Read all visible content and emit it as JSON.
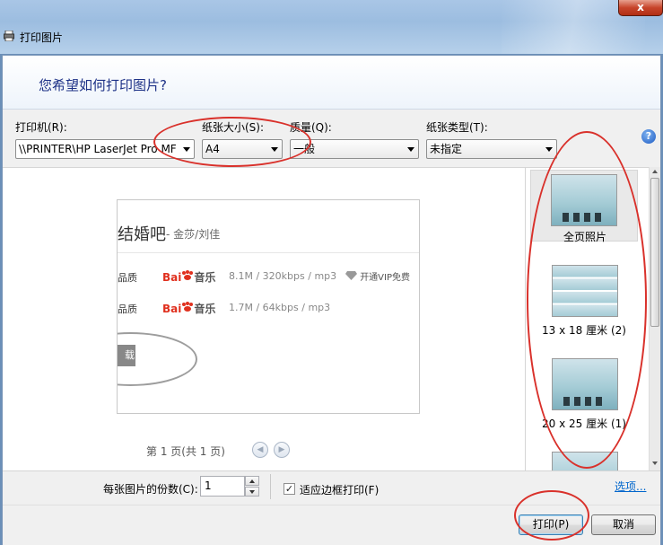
{
  "window": {
    "title": "打印图片",
    "close_label": "x"
  },
  "header": {
    "title": "您希望如何打印图片?"
  },
  "fields": {
    "printer": {
      "label": "打印机(R):",
      "value": "\\\\PRINTER\\HP LaserJet Pro MF"
    },
    "paper_size": {
      "label": "纸张大小(S):",
      "value": "A4"
    },
    "quality": {
      "label": "质量(Q):",
      "value": "一般"
    },
    "paper_type": {
      "label": "纸张类型(T):",
      "value": "未指定"
    }
  },
  "help_label": "?",
  "preview": {
    "song_title": "结婚吧",
    "artist": "- 金莎/刘佳",
    "rows": [
      {
        "quality": "品质",
        "brand": "Bai",
        "brand_suffix": "音乐",
        "size": "8.1M / 320kbps / mp3"
      },
      {
        "quality": "品质",
        "brand": "Bai",
        "brand_suffix": "音乐",
        "size": "1.7M / 64kbps / mp3"
      }
    ],
    "vip": "开通VIP免费",
    "button_fragment": "载"
  },
  "page_indicator": "第 1 页(共 1 页)",
  "nav": {
    "prev": "◀",
    "next": "▶"
  },
  "layouts": [
    {
      "label": "全页照片",
      "selected": true
    },
    {
      "label": "13 x 18 厘米 (2)",
      "selected": false
    },
    {
      "label": "20 x 25 厘米 (1)",
      "selected": false
    }
  ],
  "copies": {
    "label": "每张图片的份数(C):",
    "value": "1"
  },
  "fit_to_frame": {
    "label": "适应边框打印(F)",
    "checked": true,
    "mark": "✓"
  },
  "options_link": "选项...",
  "buttons": {
    "print": "打印(P)",
    "cancel": "取消"
  },
  "accents": {
    "header_text": "#1e3287",
    "annotation": "#d9312b",
    "link": "#0066cc"
  }
}
